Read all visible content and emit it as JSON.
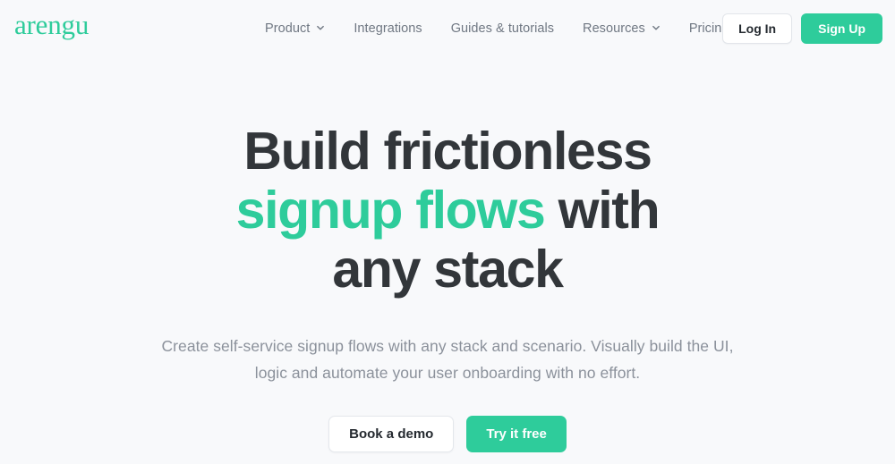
{
  "theme": {
    "background": "#f8f9fb",
    "accent": "#2ecc9b",
    "heading_color": "#32363a",
    "body_text_color": "#8b919b",
    "nav_text_color": "#707883"
  },
  "header": {
    "brand": "arengu",
    "nav": [
      {
        "label": "Product",
        "has_dropdown": true,
        "icon": "chevron-down-icon"
      },
      {
        "label": "Integrations",
        "has_dropdown": false
      },
      {
        "label": "Guides & tutorials",
        "has_dropdown": false
      },
      {
        "label": "Resources",
        "has_dropdown": true,
        "icon": "chevron-down-icon"
      },
      {
        "label": "Pricing",
        "has_dropdown": false
      }
    ],
    "actions": {
      "login_label": "Log In",
      "signup_label": "Sign Up"
    }
  },
  "hero": {
    "title_line1": "Build frictionless",
    "title_line2_green": "signup flows",
    "title_line2_rest": "with",
    "title_line3": "any stack",
    "subtitle": "Create self-service signup flows with any stack and scenario. Visually build the UI, logic and automate your user onboarding with no effort.",
    "cta": {
      "secondary_label": "Book a demo",
      "primary_label": "Try it free"
    }
  }
}
